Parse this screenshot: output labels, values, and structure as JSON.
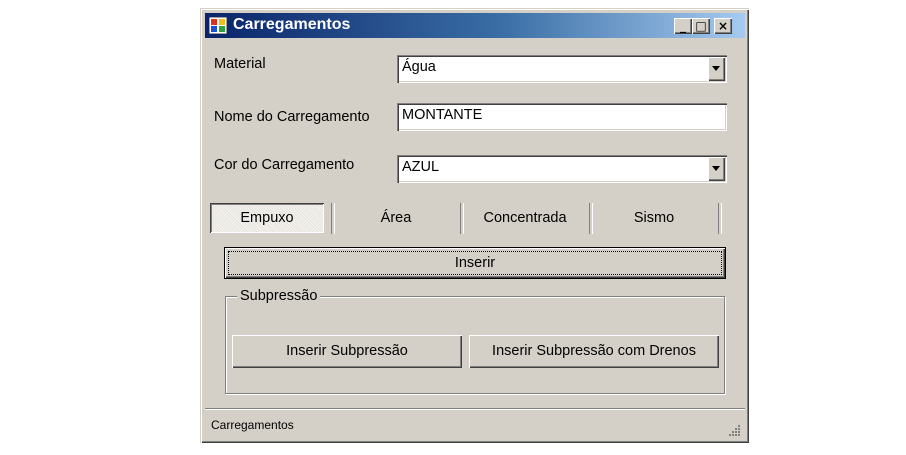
{
  "window": {
    "title": "Carregamentos",
    "minimize_symbol": "_",
    "maximize_symbol": "□",
    "close_symbol": "×"
  },
  "form": {
    "material_label": "Material",
    "material_value": "Água",
    "name_label": "Nome do Carregamento",
    "name_value": "MONTANTE",
    "color_label": "Cor do Carregamento",
    "color_value": "AZUL"
  },
  "tabs": [
    {
      "label": "Empuxo",
      "active": true
    },
    {
      "label": "Área",
      "active": false
    },
    {
      "label": "Concentrada",
      "active": false
    },
    {
      "label": "Sismo",
      "active": false
    }
  ],
  "buttons": {
    "insert": "Inserir",
    "insert_subpressure": "Inserir Subpressão",
    "insert_subpressure_drains": "Inserir Subpressão com Drenos"
  },
  "group": {
    "title": "Subpressão"
  },
  "status": {
    "text": "Carregamentos"
  },
  "icons": [
    "app-icon",
    "minimize-icon",
    "maximize-icon",
    "close-icon",
    "dropdown-arrow-icon",
    "resize-grip-icon"
  ]
}
